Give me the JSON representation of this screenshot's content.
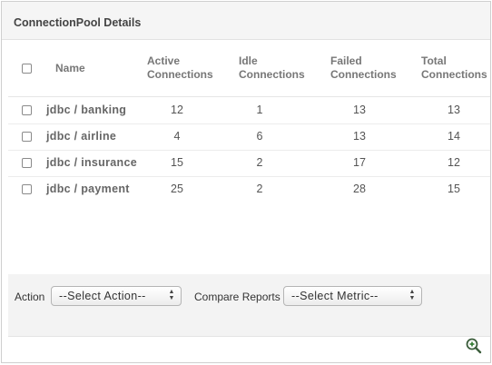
{
  "panel": {
    "title": "ConnectionPool Details"
  },
  "table": {
    "headers": {
      "name": "Name",
      "active": [
        "Active",
        "Connections"
      ],
      "idle": [
        "Idle",
        "Connections"
      ],
      "failed": [
        "Failed",
        "Connections"
      ],
      "total": [
        "Total",
        "Connections"
      ]
    },
    "rows": [
      {
        "name": "jdbc / banking",
        "active": "12",
        "idle": "1",
        "failed": "13",
        "total": "13"
      },
      {
        "name": "jdbc / airline",
        "active": "4",
        "idle": "6",
        "failed": "13",
        "total": "14"
      },
      {
        "name": "jdbc / insurance",
        "active": "15",
        "idle": "2",
        "failed": "17",
        "total": "12"
      },
      {
        "name": "jdbc / payment",
        "active": "25",
        "idle": "2",
        "failed": "28",
        "total": "15"
      }
    ]
  },
  "footer": {
    "action_label": "Action",
    "action_select": "--Select Action--",
    "compare_label": "Compare Reports",
    "metric_select": "--Select Metric--"
  },
  "icons": {
    "zoom": "zoom-in-icon"
  }
}
